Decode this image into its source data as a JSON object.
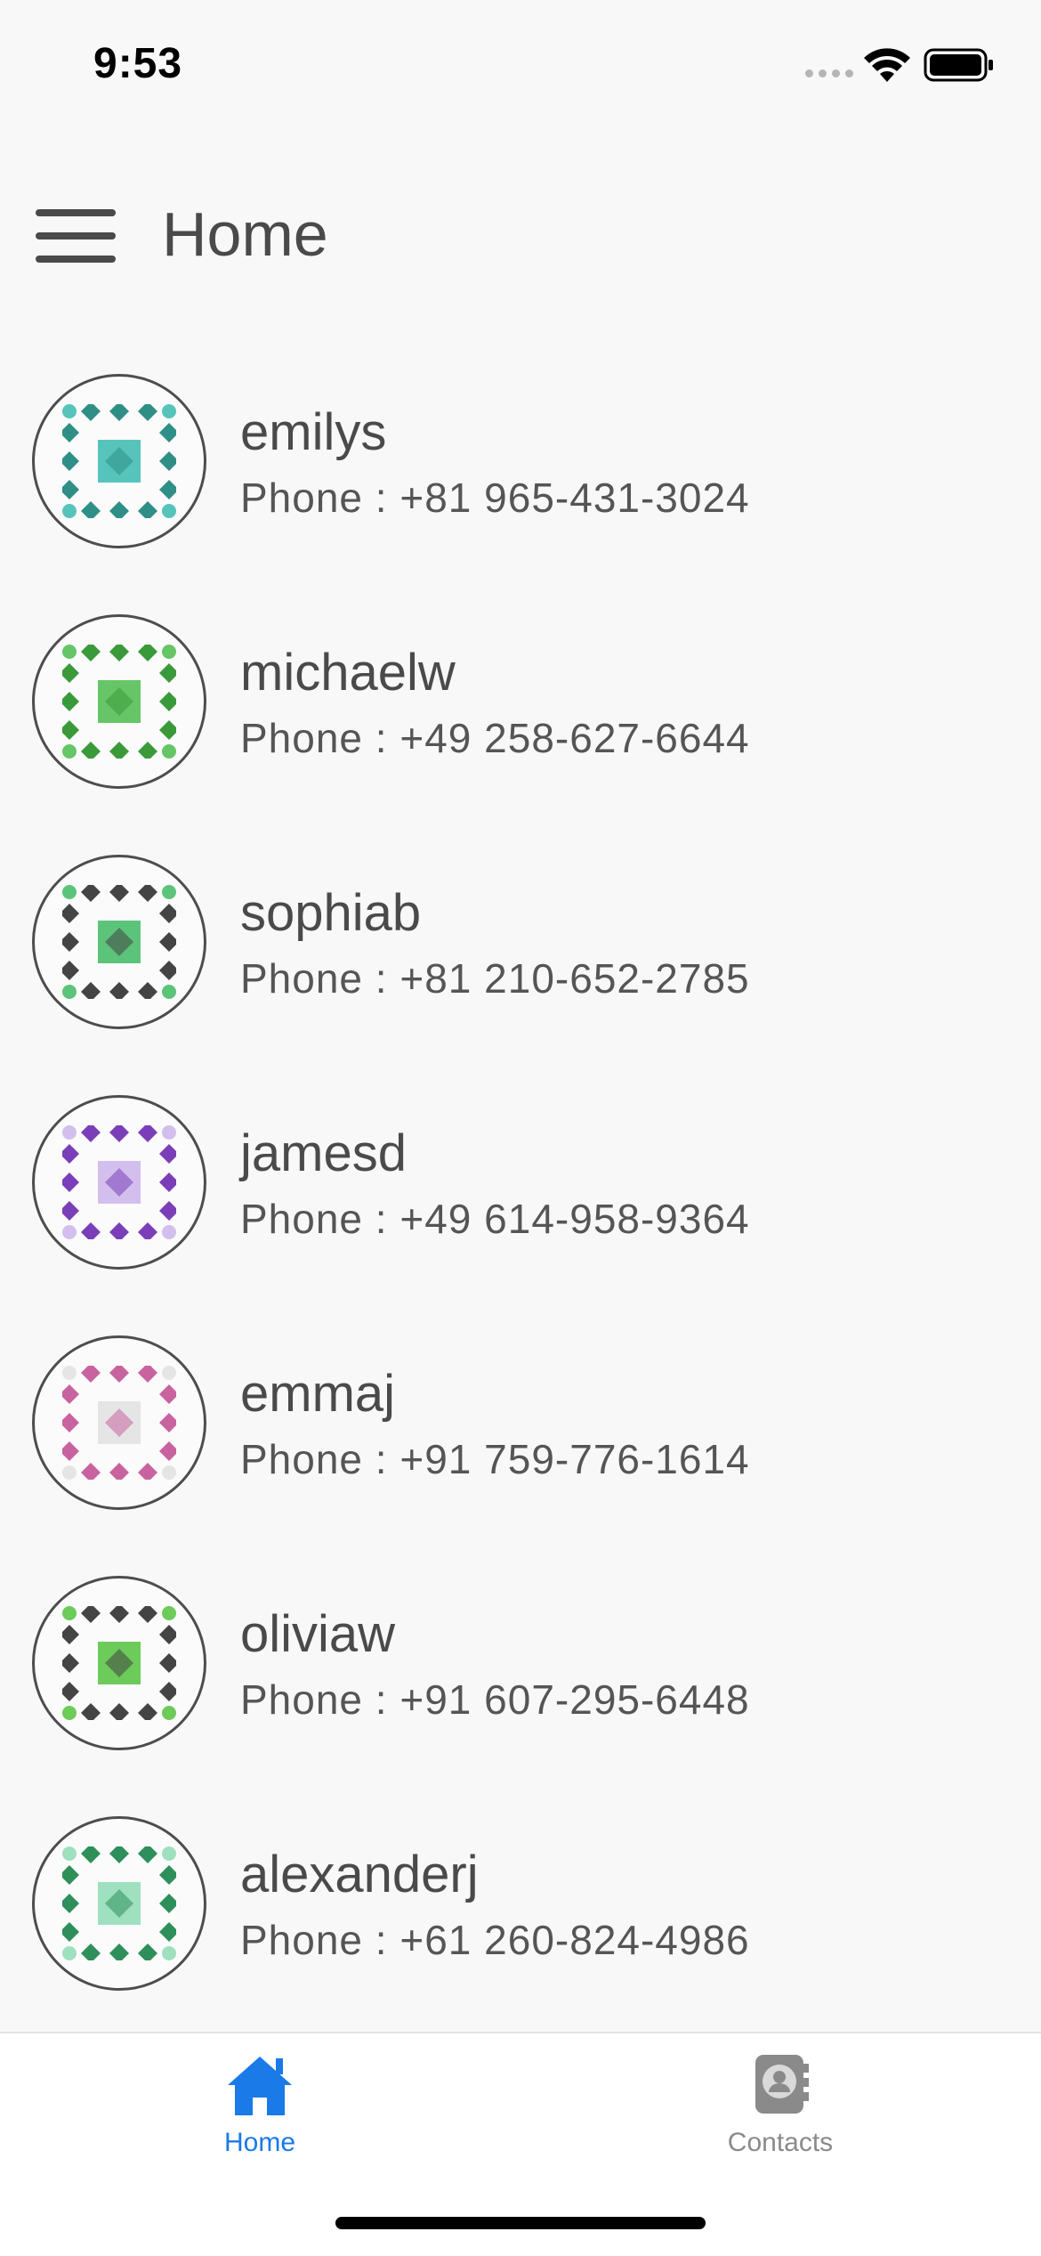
{
  "status_bar": {
    "time": "9:53"
  },
  "header": {
    "title": "Home",
    "menu_icon": "hamburger-menu-icon"
  },
  "contacts": [
    {
      "username": "emilys",
      "phone": "Phone : +81 965-431-3024",
      "avatar_color": "#2f8f86",
      "avatar_accent": "#56c4bb"
    },
    {
      "username": "michaelw",
      "phone": "Phone : +49 258-627-6644",
      "avatar_color": "#3a9a3a",
      "avatar_accent": "#66c566"
    },
    {
      "username": "sophiab",
      "phone": "Phone : +81 210-652-2785",
      "avatar_color": "#444444",
      "avatar_accent": "#5cc47a"
    },
    {
      "username": "jamesd",
      "phone": "Phone : +49 614-958-9364",
      "avatar_color": "#7a3fb8",
      "avatar_accent": "#d2bfee"
    },
    {
      "username": "emmaj",
      "phone": "Phone : +91 759-776-1614",
      "avatar_color": "#c9639f",
      "avatar_accent": "#e5e5e5"
    },
    {
      "username": "oliviaw",
      "phone": "Phone : +91 607-295-6448",
      "avatar_color": "#444444",
      "avatar_accent": "#6ccb59"
    },
    {
      "username": "alexanderj",
      "phone": "Phone : +61 260-824-4986",
      "avatar_color": "#2f8f5a",
      "avatar_accent": "#9ee0bf"
    }
  ],
  "tab_bar": {
    "tabs": [
      {
        "label": "Home",
        "icon": "house-icon",
        "active": true
      },
      {
        "label": "Contacts",
        "icon": "contacts-book-icon",
        "active": false
      }
    ]
  },
  "colors": {
    "accent": "#1a7ae8",
    "text": "#4a4a4a",
    "background": "#f8f8f8"
  }
}
